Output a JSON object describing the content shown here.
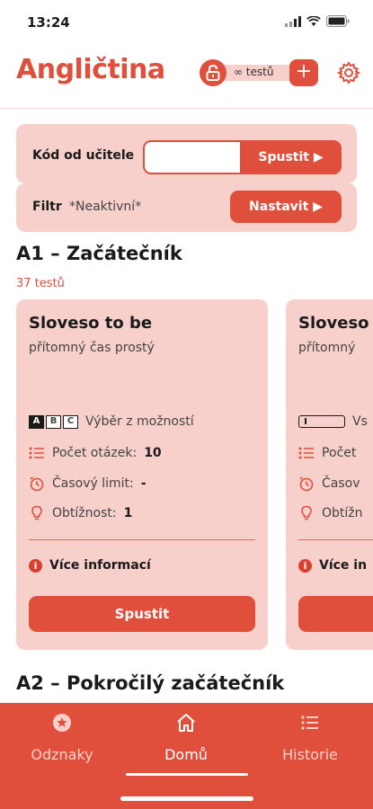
{
  "status": {
    "time": "13:24"
  },
  "header": {
    "title": "Angličtina",
    "tests_label": "∞ testů",
    "plus_label": "+"
  },
  "code_panel": {
    "label": "Kód od učitele",
    "input_value": "",
    "run_label": "Spustit ▶"
  },
  "filter_panel": {
    "label": "Filtr",
    "value": "*Neaktivní*",
    "button_label": "Nastavit ▶"
  },
  "sections": [
    {
      "title": "A1 – Začátečník",
      "count": "37 testů"
    },
    {
      "title": "A2 – Pokročilý začátečník"
    }
  ],
  "cards": [
    {
      "title": "Sloveso to be",
      "subtitle": "přítomný čas prostý",
      "type_icon": [
        "A",
        "B",
        "C"
      ],
      "type_label": "Výběr z možností",
      "questions_label": "Počet otázek:",
      "questions_value": "10",
      "time_label": "Časový limit:",
      "time_value": "-",
      "difficulty_label": "Obtížnost:",
      "difficulty_value": "1",
      "more_info": "Více informací",
      "run_label": "Spustit"
    },
    {
      "title": "Sloveso",
      "subtitle": "přítomný",
      "type_label": "Vs",
      "questions_label": "Počet",
      "time_label": "Časov",
      "difficulty_label": "Obtížn",
      "more_info": "Více in"
    }
  ],
  "nav": [
    {
      "label": "Odznaky",
      "icon": "badge-star-icon"
    },
    {
      "label": "Domů",
      "icon": "home-icon",
      "active": true
    },
    {
      "label": "Historie",
      "icon": "list-icon"
    }
  ],
  "colors": {
    "accent": "#e04e3c",
    "panel": "#f7cfcb",
    "nav_inactive": "#fbd0ca"
  }
}
